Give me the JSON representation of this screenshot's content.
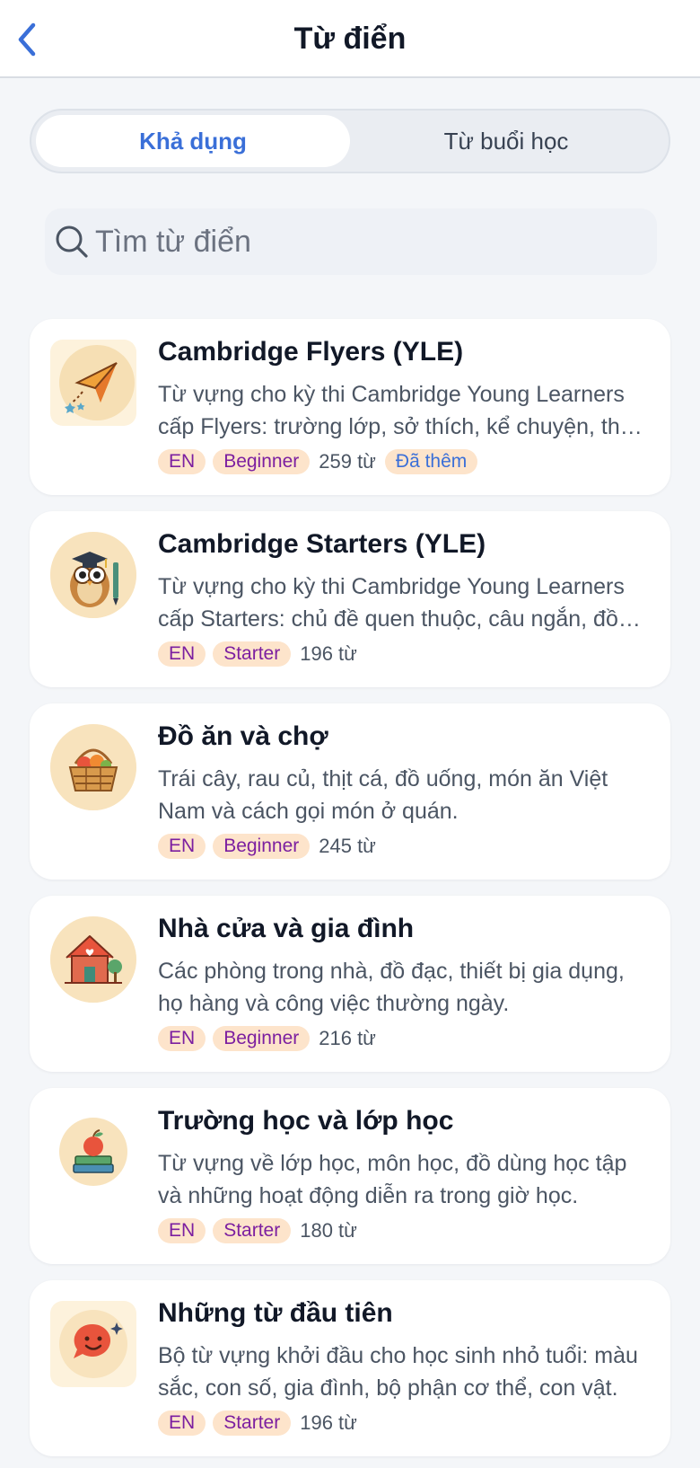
{
  "header": {
    "title": "Từ điển"
  },
  "tabs": [
    {
      "label": "Khả dụng",
      "active": true
    },
    {
      "label": "Từ buổi học",
      "active": false
    }
  ],
  "search": {
    "placeholder": "Tìm từ điển",
    "value": ""
  },
  "dictionaries": [
    {
      "title": "Cambridge Flyers (YLE)",
      "description": "Từ vựng cho kỳ thi Cambridge Young Learners cấp Flyers: trường lớp, sở thích, kể chuyện, thời tiết và những cuộc phiêu lưu.",
      "language": "EN",
      "level": "Beginner",
      "count": "259 từ",
      "status": "Đã thêm",
      "icon": "paper-plane-icon"
    },
    {
      "title": "Cambridge Starters (YLE)",
      "description": "Từ vựng cho kỳ thi Cambridge Young Learners cấp Starters: chủ đề quen thuộc, câu ngắn, đồ vật và con vật.",
      "language": "EN",
      "level": "Starter",
      "count": "196 từ",
      "icon": "owl-icon"
    },
    {
      "title": "Đồ ăn và chợ",
      "description": "Trái cây, rau củ, thịt cá, đồ uống, món ăn Việt Nam và cách gọi món ở quán.",
      "language": "EN",
      "level": "Beginner",
      "count": "245 từ",
      "icon": "fruit-basket-icon"
    },
    {
      "title": "Nhà cửa và gia đình",
      "description": "Các phòng trong nhà, đồ đạc, thiết bị gia dụng, họ hàng và công việc thường ngày.",
      "language": "EN",
      "level": "Beginner",
      "count": "216 từ",
      "icon": "house-icon"
    },
    {
      "title": "Trường học và lớp học",
      "description": "Từ vựng về lớp học, môn học, đồ dùng học tập và những hoạt động diễn ra trong giờ học.",
      "language": "EN",
      "level": "Starter",
      "count": "180 từ",
      "icon": "books-apple-icon"
    },
    {
      "title": "Những từ đầu tiên",
      "description": "Bộ từ vựng khởi đầu cho học sinh nhỏ tuổi: màu sắc, con số, gia đình, bộ phận cơ thể, con vật.",
      "language": "EN",
      "level": "Starter",
      "count": "196 từ",
      "icon": "smile-chat-icon"
    }
  ],
  "colors": {
    "accent": "#3a6fd8",
    "tag_bg": "#fde4cb",
    "tag_text": "#7c1fa0",
    "page_bg": "#f4f6f9"
  }
}
